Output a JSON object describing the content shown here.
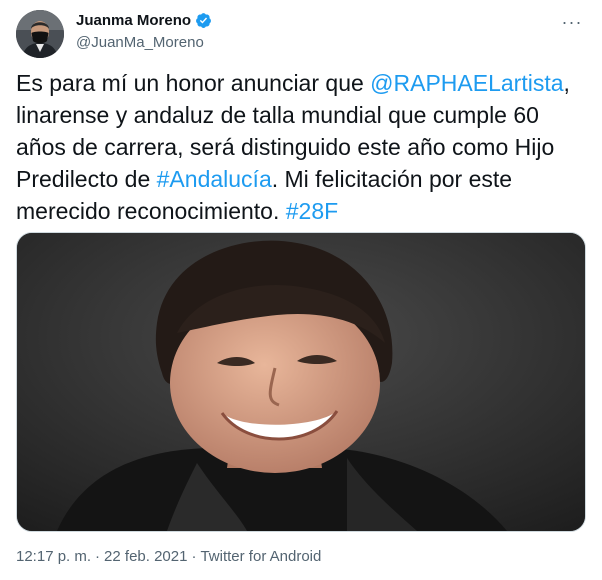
{
  "author": {
    "display_name": "Juanma Moreno",
    "handle": "@JuanMa_Moreno",
    "verified": true
  },
  "tweet": {
    "text_parts": {
      "p1": "Es para mí un honor anunciar que ",
      "mention": "@RAPHAELartista",
      "p2": ", linarense y andaluz de talla mundial que cumple 60 años de carrera, será distinguido este año como Hijo Predilecto de ",
      "hashtag1": "#Andalucía",
      "p3": ". Mi felicitación por este merecido reconocimiento. ",
      "hashtag2": "#28F"
    }
  },
  "meta": {
    "time": "12:17 p. m.",
    "separator1": "·",
    "date": "22 feb. 2021",
    "separator2": "·",
    "source": "Twitter for Android"
  },
  "more_label": "···",
  "colors": {
    "link": "#1d9bf0",
    "text": "#0f1419",
    "secondary": "#536471",
    "verified": "#1d9bf0"
  },
  "icons": {
    "verified": "verified-badge-icon",
    "more": "more-options-icon"
  }
}
